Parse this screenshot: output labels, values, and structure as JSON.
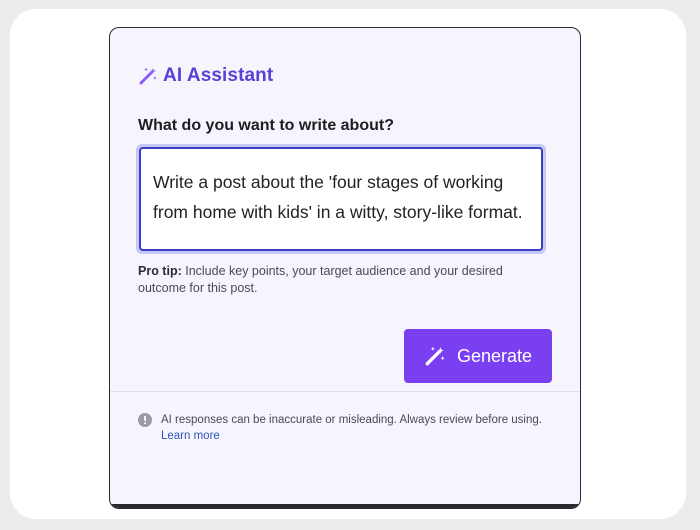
{
  "assistant": {
    "title": "AI Assistant",
    "title_icon": "magic-wand-icon",
    "accent_color": "#5b3fd6"
  },
  "prompt": {
    "question": "What do you want to write about?",
    "value": "Write a post about the 'four stages of working from home with kids' in a witty, story-like format."
  },
  "tip": {
    "label": "Pro tip:",
    "text": " Include key points, your target audience and your desired outcome for this post."
  },
  "actions": {
    "generate_label": "Generate",
    "generate_icon": "magic-wand-icon",
    "button_color": "#7b3ff2"
  },
  "disclaimer": {
    "icon": "warning-icon",
    "text": "AI responses can be inaccurate or misleading. Always review before using. ",
    "link_label": "Learn more"
  }
}
